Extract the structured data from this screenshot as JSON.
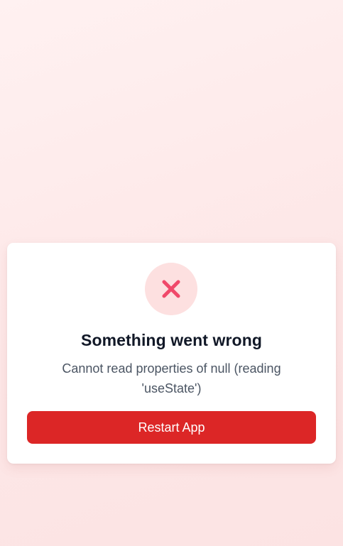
{
  "error": {
    "icon": "close-x-icon",
    "title": "Something went wrong",
    "message": "Cannot read properties of null (reading 'useState')",
    "restart_label": "Restart App"
  },
  "colors": {
    "background": "#fde7e7",
    "card": "#ffffff",
    "icon_circle": "#fde0e0",
    "icon": "#f0496a",
    "title": "#111827",
    "message": "#4b5563",
    "button": "#dc2626",
    "button_text": "#ffffff"
  }
}
